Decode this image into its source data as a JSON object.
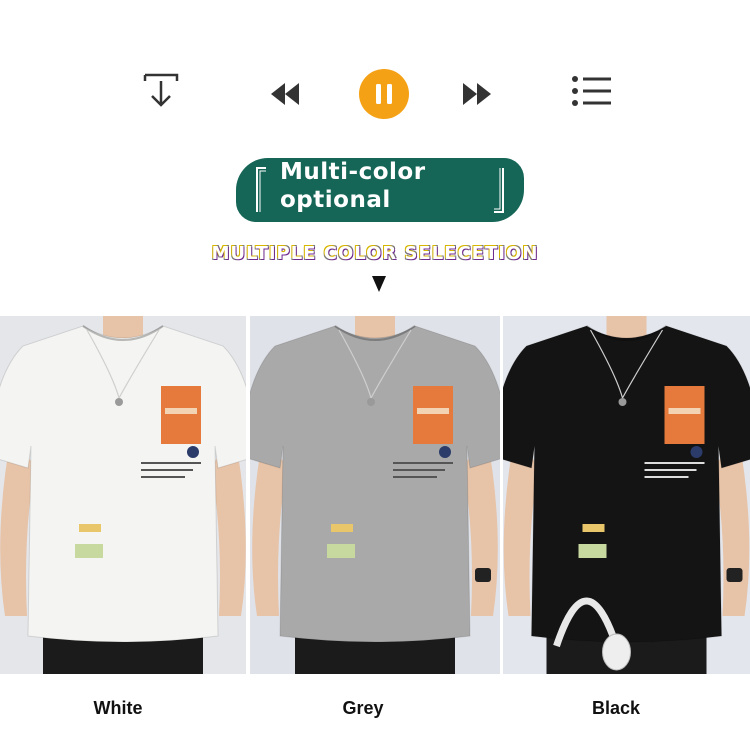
{
  "player": {
    "controls": [
      "download-icon",
      "rewind-icon",
      "pause-icon",
      "fast-forward-icon",
      "playlist-icon"
    ],
    "accent_color": "#f5a115"
  },
  "banner": {
    "line1": "Multi-color",
    "line2": "optional",
    "color": "#156657"
  },
  "subtitle": "MULTIPLE COLOR SELECETION",
  "products": [
    {
      "color_name": "White",
      "shirt_color": "#f4f4f2",
      "bg_color": "#e4e6ea"
    },
    {
      "color_name": "Grey",
      "shirt_color": "#a9a9a9",
      "bg_color": "#dfe2e8"
    },
    {
      "color_name": "Black",
      "shirt_color": "#141414",
      "bg_color": "#e3e6ec"
    }
  ]
}
